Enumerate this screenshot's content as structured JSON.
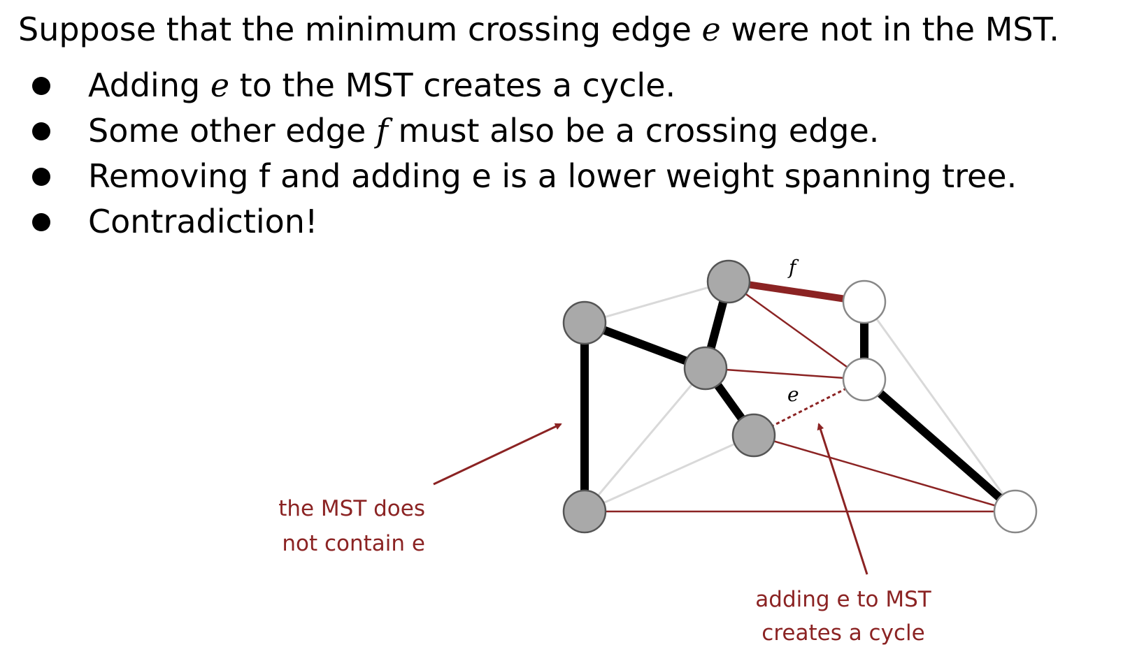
{
  "heading": {
    "before": "Suppose that the minimum crossing edge ",
    "em": "e",
    "after": " were not in the MST."
  },
  "bullets": [
    {
      "before": "Adding ",
      "em": "e",
      "after": " to the MST creates a cycle."
    },
    {
      "before": "Some other edge ",
      "em": "f",
      "after": " must also be a crossing edge."
    },
    {
      "before": "Removing f and adding e is a lower weight spanning tree.",
      "em": "",
      "after": ""
    },
    {
      "before": "Contradiction!",
      "em": "",
      "after": ""
    }
  ],
  "diagram": {
    "edge_f_label": "f",
    "edge_e_label": "e",
    "annotation_left": [
      "the MST does",
      "not contain e"
    ],
    "annotation_right": [
      "adding e to MST",
      "creates a cycle"
    ],
    "colors": {
      "mst_edge": "#000000",
      "crossing_edge": "#8b2323",
      "other_edge": "#d9d9d9",
      "gray_node": "#a9a9a9",
      "white_node": "#ffffff",
      "annotation": "#8b2323"
    }
  }
}
